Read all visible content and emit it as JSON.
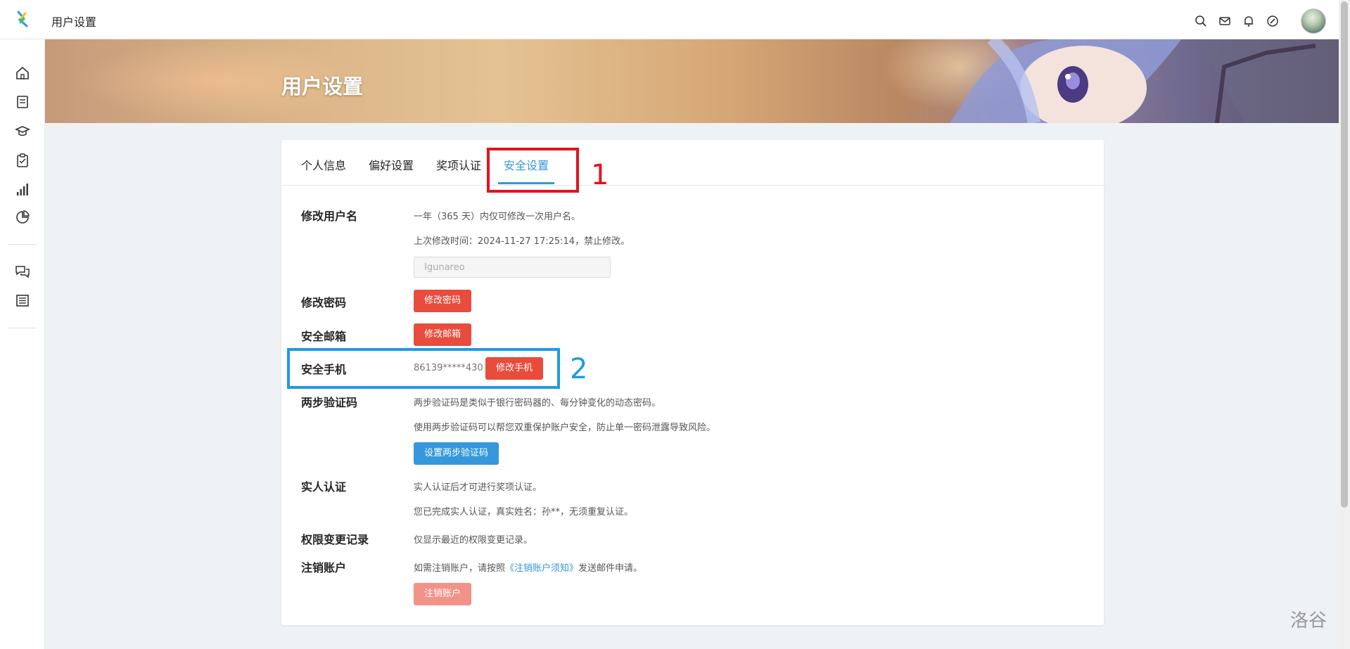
{
  "app": {
    "title": "用户设置",
    "logo_icon": "luogu-logo-icon"
  },
  "header_icons": [
    "search-icon",
    "mail-icon",
    "bell-icon",
    "pen-icon"
  ],
  "sidebar": {
    "items": [
      {
        "icon": "home-icon"
      },
      {
        "icon": "book-icon"
      },
      {
        "icon": "graduation-cap-icon"
      },
      {
        "icon": "clipboard-icon"
      },
      {
        "icon": "bar-chart-icon"
      },
      {
        "icon": "pie-chart-icon"
      },
      {
        "icon": "chat-bubbles-icon"
      },
      {
        "icon": "newspaper-icon"
      }
    ]
  },
  "banner": {
    "title": "用户设置"
  },
  "tabs": [
    {
      "label": "个人信息",
      "active": false
    },
    {
      "label": "偏好设置",
      "active": false
    },
    {
      "label": "奖项认证",
      "active": false
    },
    {
      "label": "安全设置",
      "active": true
    }
  ],
  "sections": {
    "username": {
      "label": "修改用户名",
      "desc1": "一年（365 天）内仅可修改一次用户名。",
      "desc2": "上次修改时间：2024-11-27 17:25:14，禁止修改。",
      "input_placeholder": "Igunareo"
    },
    "password": {
      "label": "修改密码",
      "button": "修改密码"
    },
    "email": {
      "label": "安全邮箱",
      "button": "修改邮箱"
    },
    "phone": {
      "label": "安全手机",
      "value": "86139*****430",
      "button": "修改手机"
    },
    "two_step": {
      "label": "两步验证码",
      "desc1": "两步验证码是类似于银行密码器的、每分钟变化的动态密码。",
      "desc2": "使用两步验证码可以帮您双重保护账户安全，防止单一密码泄露导致风险。",
      "button": "设置两步验证码"
    },
    "realname": {
      "label": "实人认证",
      "desc1": "实人认证后才可进行奖项认证。",
      "desc2": "您已完成实人认证，真实姓名：孙**，无须重复认证。"
    },
    "permission_log": {
      "label": "权限变更记录",
      "desc": "仅显示最近的权限变更记录。"
    },
    "delete_account": {
      "label": "注销账户",
      "desc_prefix": "如需注销账户，请按照",
      "desc_link": "《注销账户须知》",
      "desc_suffix": "发送邮件申请。",
      "button": "注销账户"
    }
  },
  "annotations": {
    "first": "1",
    "second": "2"
  },
  "watermark": "洛谷",
  "colors": {
    "accent_blue": "#3498db",
    "danger_red": "#e74c3c",
    "annotation_red": "#e0141e",
    "annotation_blue": "#1e9be0"
  }
}
